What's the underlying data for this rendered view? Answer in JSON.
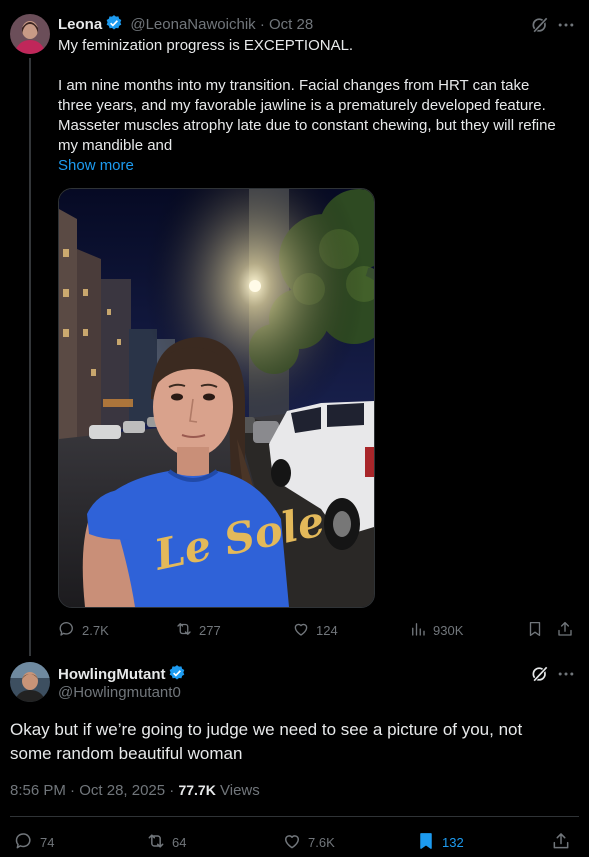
{
  "tweet1": {
    "author_name": "Leona",
    "handle": "@LeonaNawoichik",
    "separator": "·",
    "date": "Oct 28",
    "lines": [
      "My feminization progress is EXCEPTIONAL.",
      "",
      "I am nine months into my transition. Facial changes from HRT can take",
      "three years, and my favorable jawline is a prematurely developed feature.",
      "Masseter muscles atrophy late due to constant chewing, but they will refine",
      "my mandible and"
    ],
    "show_more": "Show more",
    "shirt_text": "Le Sole",
    "actions": {
      "replies": "2.7K",
      "reposts": "277",
      "likes": "124",
      "views": "930K"
    }
  },
  "tweet2": {
    "author_name": "HowlingMutant",
    "handle": "@Howlingmutant0",
    "text_line1": "Okay but if we’re going to judge we need to see a picture of you, not",
    "text_line2": "some random beautiful woman",
    "time": "8:56 PM",
    "date": "Oct 28, 2025",
    "separator": "·",
    "views_count": "77.7K",
    "views_label": "Views",
    "actions": {
      "replies": "74",
      "reposts": "64",
      "likes": "7.6K",
      "bookmarks": "132"
    }
  },
  "icons": [
    "grok-icon",
    "more-icon",
    "verified-icon",
    "reply-icon",
    "repost-icon",
    "like-icon",
    "views-icon",
    "bookmark-icon",
    "share-icon"
  ],
  "colors": {
    "accent": "#1d9bf0",
    "muted": "#71767b",
    "text": "#e7e9ea",
    "background": "#000000",
    "divider": "#2f3336"
  }
}
